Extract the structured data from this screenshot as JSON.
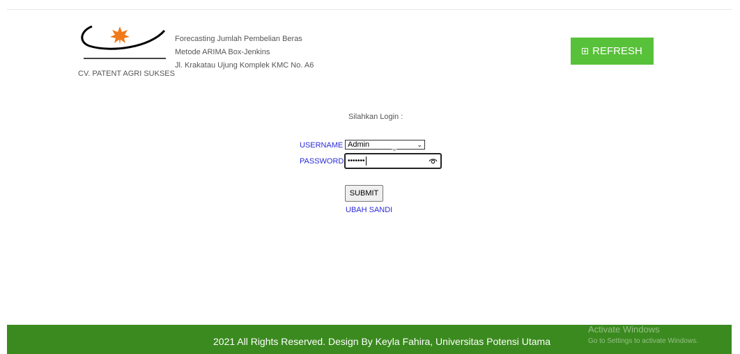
{
  "header": {
    "company_name": "CV. PATENT AGRI SUKSES",
    "lines": [
      "Forecasting Jumlah Pembelian Beras",
      "Metode ARIMA Box-Jenkins",
      "Jl. Krakatau Ujung Komplek KMC No. A6"
    ],
    "refresh_label": "REFRESH",
    "refresh_icon": "plus-square-icon"
  },
  "login": {
    "prompt": "Silahkan Login :",
    "username_label": "USERNAME",
    "username_value": "Admin",
    "password_label": "PASSWORD",
    "password_mask": "•••••••",
    "submit_label": "SUBMIT",
    "change_password_label": "UBAH SANDI"
  },
  "footer": {
    "text": "2021 All Rights Reserved. Design By Keyla Fahira, Universitas Potensi Utama"
  },
  "watermark": {
    "title": "Activate Windows",
    "subtitle": "Go to Settings to activate Windows."
  },
  "colors": {
    "refresh_button": "#58c13a",
    "footer_background": "#3b8a1f",
    "label_blue": "#2b2bd8",
    "logo_leaf": "#f07a1a"
  }
}
